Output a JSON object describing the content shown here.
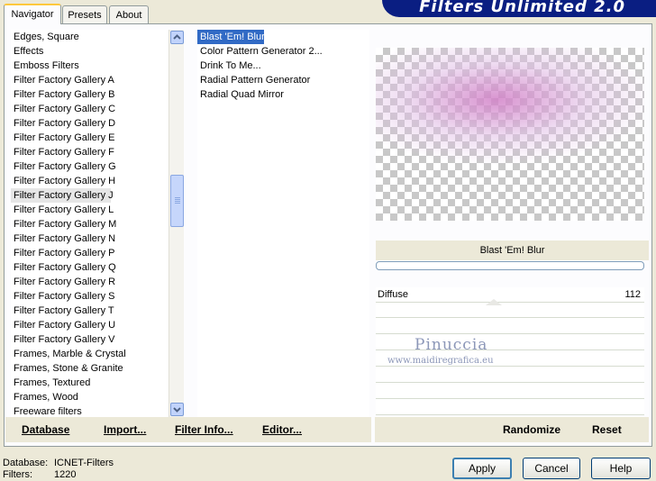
{
  "header": {
    "title": "Filters Unlimited 2.0"
  },
  "tabs": [
    {
      "label": "Navigator",
      "active": true
    },
    {
      "label": "Presets",
      "active": false
    },
    {
      "label": "About",
      "active": false
    }
  ],
  "categories": {
    "selected": "Filter Factory Gallery J",
    "items": [
      "Edges, Square",
      "Effects",
      "Emboss Filters",
      "Filter Factory Gallery A",
      "Filter Factory Gallery B",
      "Filter Factory Gallery C",
      "Filter Factory Gallery D",
      "Filter Factory Gallery E",
      "Filter Factory Gallery F",
      "Filter Factory Gallery G",
      "Filter Factory Gallery H",
      "Filter Factory Gallery J",
      "Filter Factory Gallery L",
      "Filter Factory Gallery M",
      "Filter Factory Gallery N",
      "Filter Factory Gallery P",
      "Filter Factory Gallery Q",
      "Filter Factory Gallery R",
      "Filter Factory Gallery S",
      "Filter Factory Gallery T",
      "Filter Factory Gallery U",
      "Filter Factory Gallery V",
      "Frames, Marble & Crystal",
      "Frames, Stone & Granite",
      "Frames, Textured",
      "Frames, Wood",
      "Freeware filters"
    ]
  },
  "filters": {
    "selected": "Blast 'Em! Blur",
    "items": [
      "Blast 'Em! Blur",
      "Color Pattern Generator 2...",
      "Drink To Me...",
      "Radial Pattern Generator",
      "Radial Quad Mirror"
    ]
  },
  "left_toolbar": {
    "database": "Database",
    "import": "Import...",
    "filter_info": "Filter Info...",
    "editor": "Editor..."
  },
  "right_toolbar": {
    "randomize": "Randomize",
    "reset": "Reset"
  },
  "preview": {
    "filter_name": "Blast 'Em! Blur",
    "progress": 0
  },
  "parameters": [
    {
      "label": "Diffuse",
      "value": "112"
    }
  ],
  "watermark": {
    "name": "Pinuccia",
    "url": "www.maidiregrafica.eu"
  },
  "footer": {
    "database_label": "Database:",
    "database_value": "ICNET-Filters",
    "filters_label": "Filters:",
    "filters_value": "1220"
  },
  "buttons": {
    "apply": "Apply",
    "cancel": "Cancel",
    "help": "Help"
  },
  "icons": {
    "scroll_up": "chevron-up-icon",
    "scroll_down": "chevron-down-icon"
  },
  "colors": {
    "banner": "#0a1e82",
    "selection": "#316ac5",
    "active_tab": "#ffc83c"
  }
}
